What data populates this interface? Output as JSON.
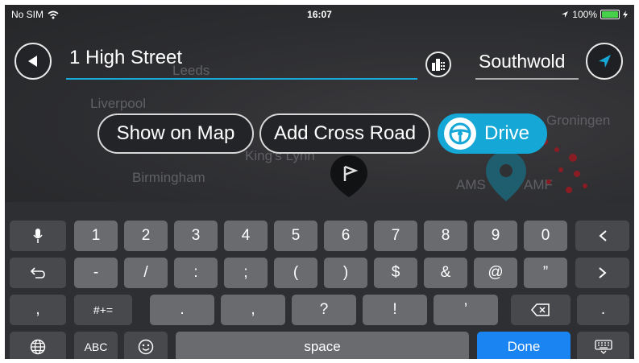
{
  "status_bar": {
    "carrier": "No SIM",
    "time": "16:07",
    "battery": "100%",
    "battery_level": 1.0
  },
  "map": {
    "cities": [
      "Leeds",
      "Liverpool",
      "Birmingham",
      "King's Lynn",
      "Groningen",
      "AMS",
      "AMF"
    ]
  },
  "search": {
    "query": "1 High Street",
    "city": "Southwold"
  },
  "actions": {
    "show_on_map": "Show on Map",
    "add_cross_road": "Add Cross Road",
    "drive": "Drive"
  },
  "keyboard": {
    "row1": [
      "1",
      "2",
      "3",
      "4",
      "5",
      "6",
      "7",
      "8",
      "9",
      "0"
    ],
    "row2": [
      "-",
      "/",
      ":",
      ";",
      "(",
      ")",
      "$",
      "&",
      "@",
      "”"
    ],
    "row3": [
      ".",
      ",",
      "?",
      "!",
      "’"
    ],
    "symbols_key": "#+=",
    "abc_key": "ABC",
    "space_key": "space",
    "done_key": "Done",
    "comma_key": ",",
    "period_key": "."
  },
  "colors": {
    "accent": "#15a8d6",
    "done": "#1a84f2",
    "key": "#6a6b6f",
    "key_dark": "#48494d"
  }
}
